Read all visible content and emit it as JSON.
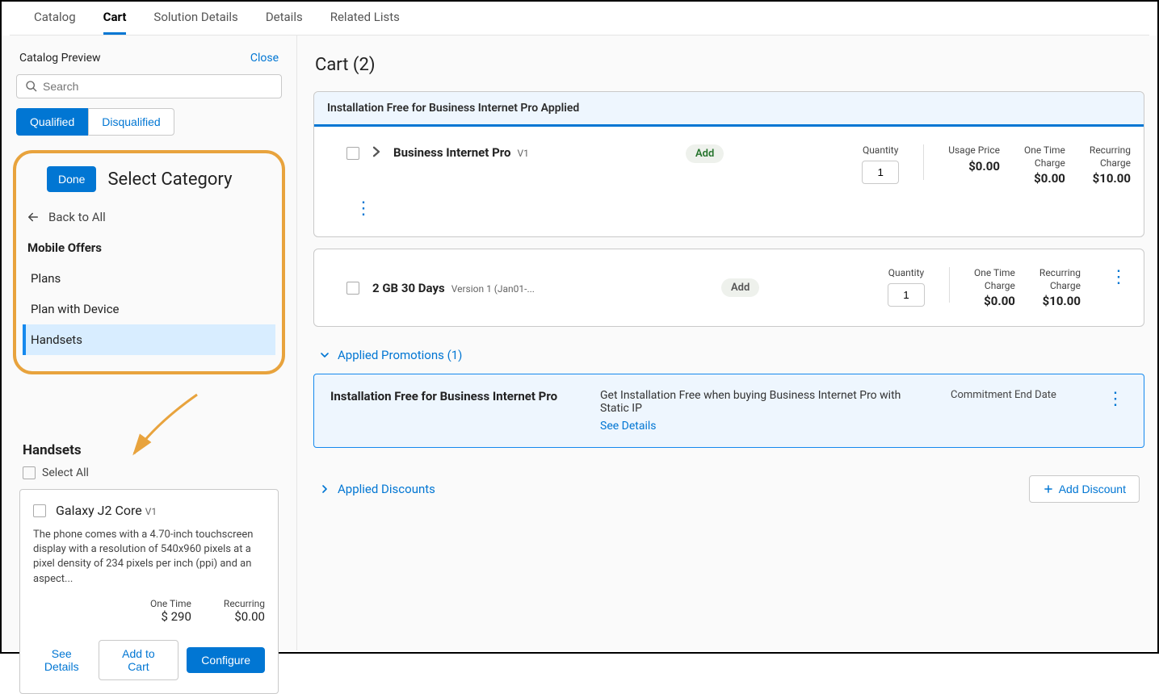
{
  "tabs": [
    "Catalog",
    "Cart",
    "Solution Details",
    "Details",
    "Related Lists"
  ],
  "active_tab": "Cart",
  "sidebar": {
    "title": "Catalog Preview",
    "close": "Close",
    "search_placeholder": "Search",
    "seg_qualified": "Qualified",
    "seg_disqualified": "Disqualified",
    "done": "Done",
    "select_category": "Select Category",
    "back": "Back to All",
    "group": "Mobile Offers",
    "items": [
      "Plans",
      "Plan with Device",
      "Handsets"
    ],
    "selected_item": "Handsets",
    "handsets_title": "Handsets",
    "select_all": "Select All"
  },
  "product": {
    "name": "Galaxy J2 Core",
    "version": "V1",
    "desc": "The phone comes with a 4.70-inch touchscreen display with a resolution of 540x960 pixels at a pixel density of 234 pixels per inch (ppi) and an aspect...",
    "one_time_label": "One Time",
    "one_time_value": "$ 290",
    "recurring_label": "Recurring",
    "recurring_value": "$0.00",
    "see_details": "See Details",
    "add_to_cart": "Add to Cart",
    "configure": "Configure"
  },
  "cart": {
    "title": "Cart (2)",
    "banner": "Installation Free for Business Internet Pro Applied",
    "items": [
      {
        "name": "Business Internet Pro",
        "version": "V1",
        "add": "Add",
        "add_style": "green",
        "quantity_label": "Quantity",
        "quantity": "1",
        "cols": [
          {
            "l1": "Usage Price",
            "l2": "",
            "v": "$0.00"
          },
          {
            "l1": "One Time",
            "l2": "Charge",
            "v": "$0.00"
          },
          {
            "l1": "Recurring",
            "l2": "Charge",
            "v": "$10.00"
          }
        ],
        "expandable": true,
        "kebab_row": true
      },
      {
        "name": "2 GB 30 Days",
        "version": "Version 1 (Jan01-...",
        "add": "Add",
        "add_style": "grey",
        "quantity_label": "Quantity",
        "quantity": "1",
        "cols": [
          {
            "l1": "One Time",
            "l2": "Charge",
            "v": "$0.00"
          },
          {
            "l1": "Recurring",
            "l2": "Charge",
            "v": "$10.00"
          }
        ],
        "expandable": false,
        "kebab_inline": true
      }
    ],
    "promotions_head": "Applied Promotions (1)",
    "promo": {
      "title": "Installation Free for Business Internet Pro",
      "desc": "Get Installation Free when buying Business Internet Pro with Static IP",
      "see": "See Details",
      "commit": "Commitment End Date"
    },
    "discounts_head": "Applied Discounts",
    "add_discount": "Add Discount"
  }
}
